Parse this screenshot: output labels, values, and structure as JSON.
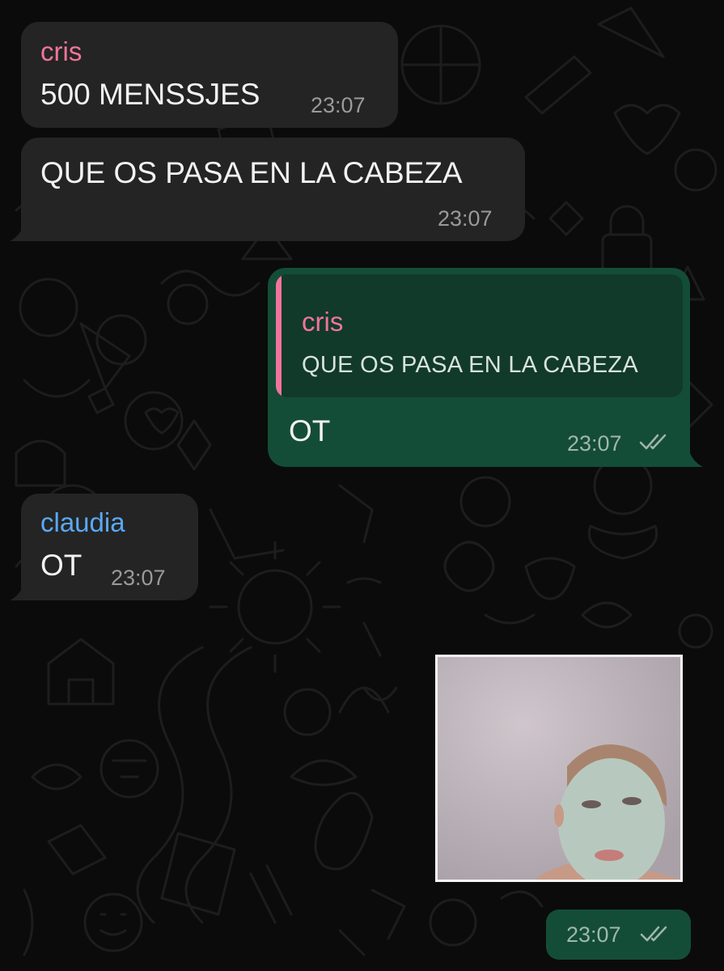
{
  "messages": [
    {
      "sender": "cris",
      "text": "500 MENSSJES",
      "time": "23:07",
      "direction": "incoming"
    },
    {
      "text": "QUE OS PASA EN LA CABEZA",
      "time": "23:07",
      "direction": "incoming"
    },
    {
      "quote": {
        "sender": "cris",
        "text": "QUE OS PASA EN LA CABEZA"
      },
      "text": "OT",
      "time": "23:07",
      "status": "read",
      "direction": "outgoing"
    },
    {
      "sender": "claudia",
      "text": "OT",
      "time": "23:07",
      "direction": "incoming"
    },
    {
      "type": "photo",
      "time": "23:07",
      "status": "read",
      "direction": "outgoing"
    }
  ],
  "colors": {
    "background": "#0b0b0b",
    "incoming_bubble": "#242424",
    "outgoing_bubble": "#144d37",
    "sender_cris": "#f0759a",
    "sender_claudia": "#5aa8f4"
  },
  "icons": {
    "read_receipt": "double-check-icon"
  }
}
